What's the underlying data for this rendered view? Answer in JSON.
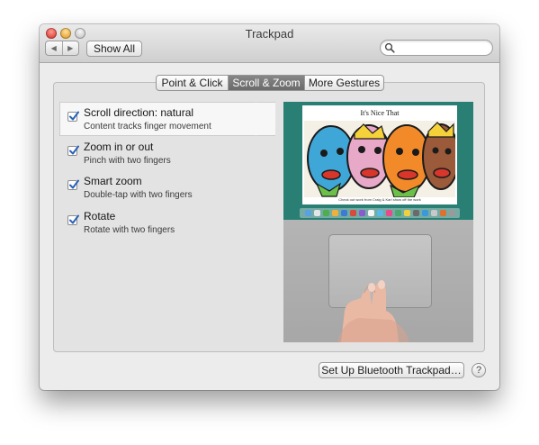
{
  "window": {
    "title": "Trackpad"
  },
  "toolbar": {
    "back_glyph": "◀",
    "forward_glyph": "▶",
    "show_all_label": "Show All",
    "search_value": "",
    "search_placeholder": ""
  },
  "tabs": [
    {
      "label": "Point & Click",
      "selected": false
    },
    {
      "label": "Scroll & Zoom",
      "selected": true
    },
    {
      "label": "More Gestures",
      "selected": false
    }
  ],
  "options": [
    {
      "title": "Scroll direction: natural",
      "description": "Content tracks finger movement",
      "checked": true,
      "selected": true
    },
    {
      "title": "Zoom in or out",
      "description": "Pinch with two fingers",
      "checked": true,
      "selected": false
    },
    {
      "title": "Smart zoom",
      "description": "Double-tap with two fingers",
      "checked": true,
      "selected": false
    },
    {
      "title": "Rotate",
      "description": "Rotate with two fingers",
      "checked": true,
      "selected": false
    }
  ],
  "preview": {
    "site_title": "It's Nice That",
    "caption": "Check out work from Craig & Karl show off the work"
  },
  "footer": {
    "bluetooth_button_label": "Set Up Bluetooth Trackpad…",
    "help_label": "?"
  },
  "colors": {
    "window_bg": "#ececec",
    "selected_tab_bg": "#7a7a7a",
    "checkbox_check": "#2a63b6",
    "preview_desktop": "#2a7f74"
  },
  "icons": {
    "search": "magnifier-icon",
    "checkbox": "checkmark-icon",
    "help": "question-icon"
  }
}
